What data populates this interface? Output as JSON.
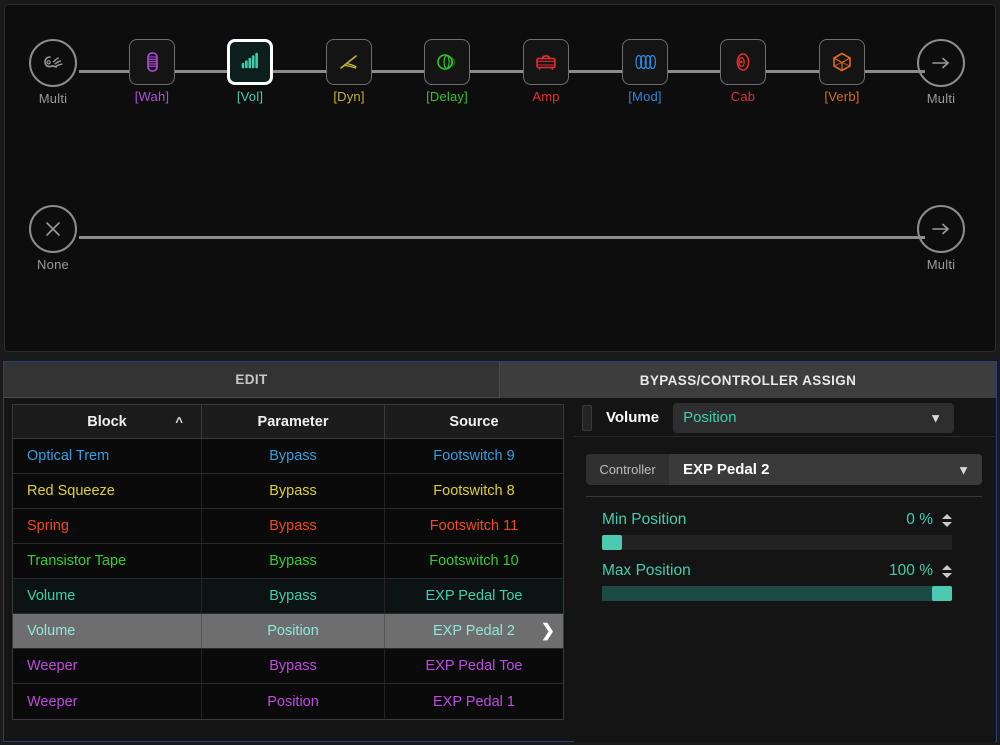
{
  "signal_chain": {
    "row1": [
      {
        "label": "Multi",
        "icon": "guitar-input-icon",
        "color": "#9a9a9a",
        "shape": "round",
        "selected": false
      },
      {
        "label": "[Wah]",
        "icon": "wah-pedal-icon",
        "color": "#b24cd8",
        "shape": "square",
        "selected": false
      },
      {
        "label": "[Vol]",
        "icon": "volume-bars-icon",
        "color": "#3fcfb0",
        "shape": "square",
        "selected": true
      },
      {
        "label": "[Dyn]",
        "icon": "compressor-icon",
        "color": "#c8b134",
        "shape": "square",
        "selected": false
      },
      {
        "label": "[Delay]",
        "icon": "delay-echo-icon",
        "color": "#2fc42f",
        "shape": "square",
        "selected": false
      },
      {
        "label": "Amp",
        "icon": "amp-head-icon",
        "color": "#e03030",
        "shape": "square",
        "selected": false
      },
      {
        "label": "[Mod]",
        "icon": "modulation-wave-icon",
        "color": "#2f86d8",
        "shape": "square",
        "selected": false
      },
      {
        "label": "Cab",
        "icon": "cabinet-speaker-icon",
        "color": "#e03030",
        "shape": "square",
        "selected": false
      },
      {
        "label": "[Verb]",
        "icon": "reverb-cube-icon",
        "color": "#e06a1e",
        "shape": "square",
        "selected": false
      },
      {
        "label": "Multi",
        "icon": "output-arrow-icon",
        "color": "#9a9a9a",
        "shape": "round",
        "selected": false
      }
    ],
    "row2": [
      {
        "label": "None",
        "icon": "no-input-icon",
        "color": "#9a9a9a",
        "shape": "round",
        "selected": false
      },
      {
        "label": "Multi",
        "icon": "output-arrow-icon",
        "color": "#9a9a9a",
        "shape": "round",
        "selected": false
      }
    ]
  },
  "tabs": {
    "edit": "EDIT",
    "assign": "BYPASS/CONTROLLER ASSIGN"
  },
  "table": {
    "headers": {
      "block": "Block",
      "parameter": "Parameter",
      "source": "Source"
    },
    "sort_icon": "chevron-up-icon",
    "rows": [
      {
        "block": "Optical Trem",
        "parameter": "Bypass",
        "source": "Footswitch 9",
        "color": "#2f9fe0",
        "selected": false
      },
      {
        "block": "Red Squeeze",
        "parameter": "Bypass",
        "source": "Footswitch 8",
        "color": "#e0d02f",
        "selected": false
      },
      {
        "block": "Spring",
        "parameter": "Bypass",
        "source": "Footswitch 11",
        "color": "#f04a1e",
        "selected": false
      },
      {
        "block": "Transistor Tape",
        "parameter": "Bypass",
        "source": "Footswitch 10",
        "color": "#30d030",
        "selected": false
      },
      {
        "block": "Volume",
        "parameter": "Bypass",
        "source": "EXP Pedal Toe",
        "color": "#3fcfb0",
        "selected": false
      },
      {
        "block": "Volume",
        "parameter": "Position",
        "source": "EXP Pedal 2",
        "color": "#8fe8d8",
        "selected": true
      },
      {
        "block": "Weeper",
        "parameter": "Bypass",
        "source": "EXP Pedal Toe",
        "color": "#c04ae0",
        "selected": false
      },
      {
        "block": "Weeper",
        "parameter": "Position",
        "source": "EXP Pedal 1",
        "color": "#c04ae0",
        "selected": false
      }
    ],
    "row_caret_icon": "chevron-right-icon"
  },
  "detail": {
    "block_name": "Volume",
    "parameter": "Position",
    "parameter_dropdown_icon": "chevron-down-icon",
    "controller_label": "Controller",
    "controller_value": "EXP Pedal 2",
    "controller_dropdown_icon": "chevron-down-icon",
    "min": {
      "label": "Min Position",
      "value": "0 %",
      "percent": 0
    },
    "max": {
      "label": "Max Position",
      "value": "100 %",
      "percent": 100
    }
  },
  "colors": {
    "accent_teal": "#3fcfb0",
    "panel_border_blue": "#2a3f7a",
    "selected_row": "#6e6e6e"
  }
}
